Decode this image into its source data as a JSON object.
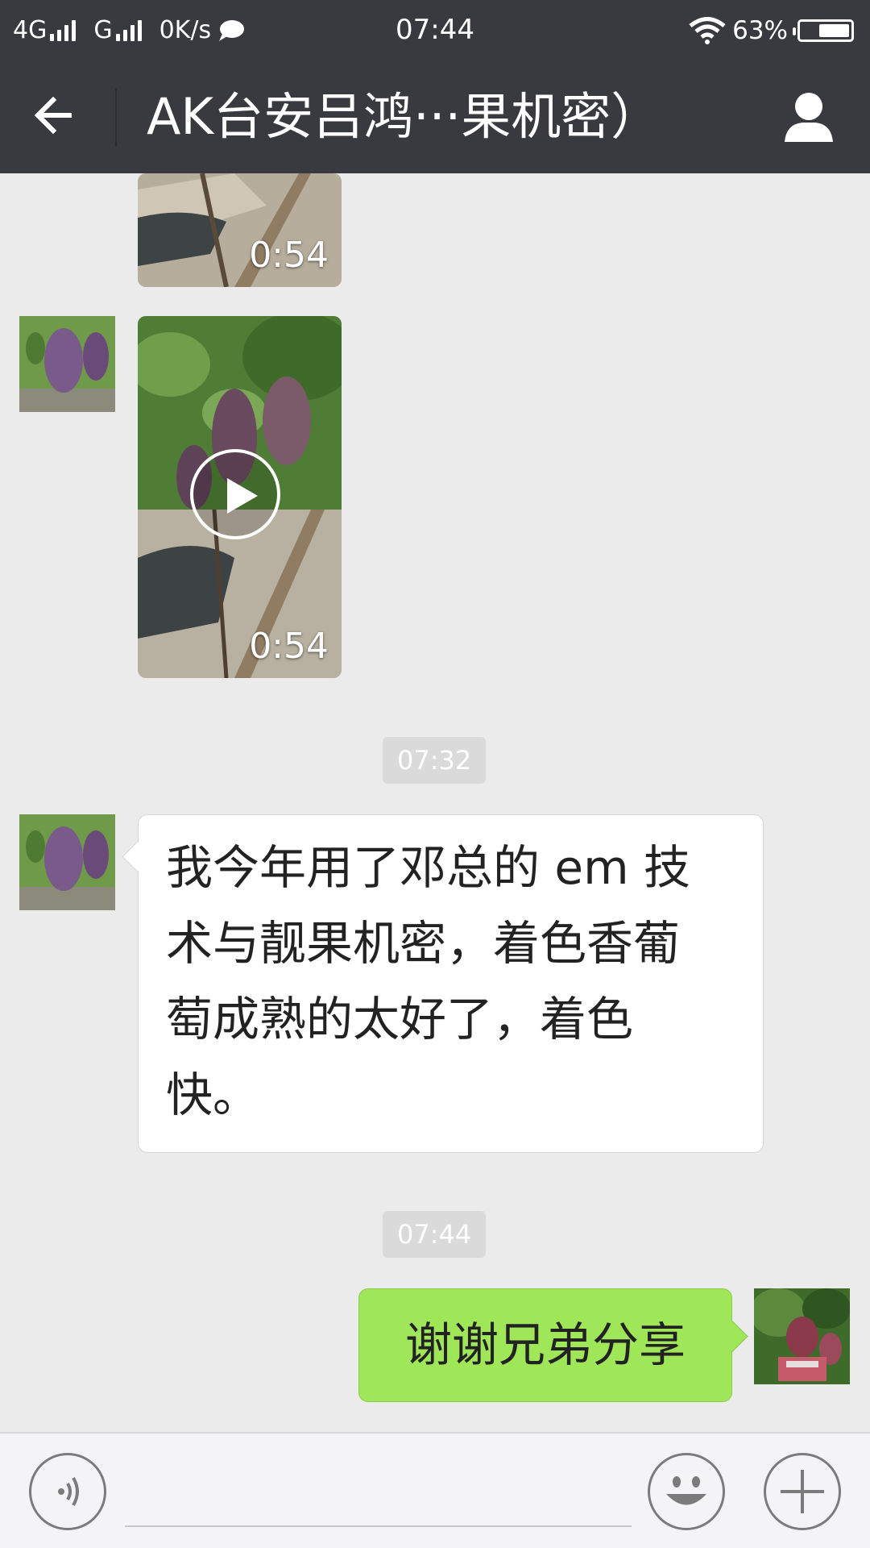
{
  "status_bar": {
    "network_1": "4G",
    "network_2": "G",
    "speed": "0K/s",
    "time": "07:44",
    "battery": "63%",
    "battery_level": 0.63
  },
  "title_bar": {
    "title": "AK台安吕鸿···果机密）",
    "back_icon": "arrow-left-icon",
    "profile_icon": "person-icon"
  },
  "messages": {
    "video_1_duration": "0:54",
    "video_2_duration": "0:54",
    "timestamp_1": "07:32",
    "incoming_text_lines": [
      "我今年用了邓总的 em 技",
      "术与靓果机密，着色香葡",
      "萄成熟的太好了，着色",
      "快。"
    ],
    "timestamp_2": "07:44",
    "outgoing_text": "谢谢兄弟分享"
  },
  "input_bar": {
    "voice_icon": "voice-icon",
    "emoji_icon": "emoji-icon",
    "plus_icon": "plus-icon",
    "placeholder": ""
  },
  "colors": {
    "header": "#393a3f",
    "chat_bg": "#ebebeb",
    "outgoing_bubble": "#9fe658",
    "timestamp_bg": "#dadada"
  }
}
